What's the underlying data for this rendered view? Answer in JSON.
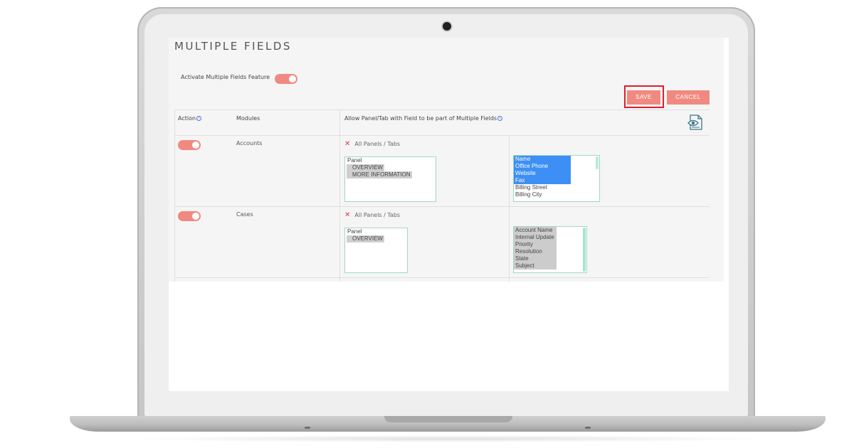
{
  "page": {
    "title": "MULTIPLE FIELDS",
    "activate_label": "Activate Multiple Fields Feature",
    "activate_on": true
  },
  "buttons": {
    "save": "SAVE",
    "cancel": "CANCEL"
  },
  "table": {
    "headers": {
      "action": "Action",
      "modules": "Modules",
      "allow": "Allow Panel/Tab with Field to be part of Multiple Fields"
    },
    "rows": [
      {
        "enabled": true,
        "module": "Accounts",
        "all_panels_label": "All Panels / Tabs",
        "panel_group": "Panel",
        "panels": [
          "OVERVIEW",
          "MORE INFORMATION"
        ],
        "fields": [
          "Name",
          "Office Phone",
          "Website",
          "Fax",
          "Billing Street",
          "Billing City"
        ],
        "fields_selected_count": 4
      },
      {
        "enabled": true,
        "module": "Cases",
        "all_panels_label": "All Panels / Tabs",
        "panel_group": "Panel",
        "panels": [
          "OVERVIEW"
        ],
        "fields": [
          "Account Name",
          "Internal Update",
          "Priority",
          "Resolution",
          "State",
          "Subject"
        ],
        "fields_selected_count": 6
      }
    ]
  },
  "colors": {
    "accent": "#f08a80",
    "highlight_border": "#e11d2a",
    "selected_blue": "#3d8ff5",
    "listbox_border": "#9fd8c6"
  },
  "icons": {
    "info": "info-circle-icon",
    "preview": "preview-eye-icon",
    "remove": "close-x-icon"
  }
}
